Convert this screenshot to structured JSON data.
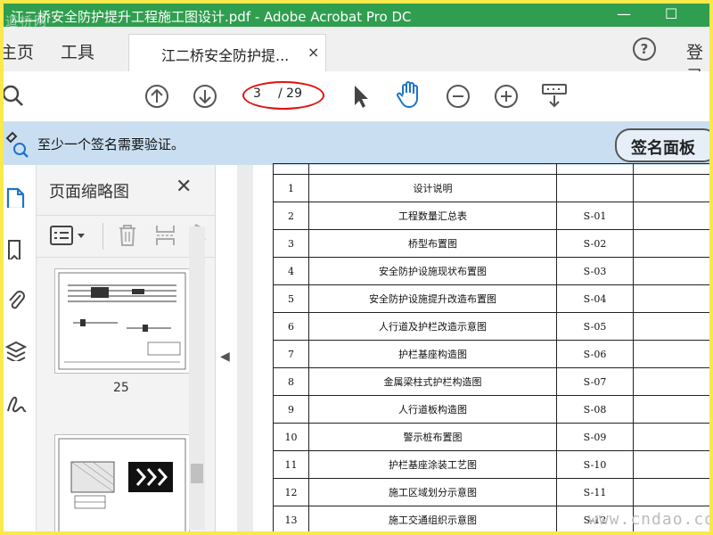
{
  "window": {
    "title": "江二桥安全防护提升工程施工图设计.pdf - Adobe Acrobat Pro DC",
    "watermark_logo": "道桥网",
    "minimize": "—",
    "maximize": "☐"
  },
  "tabs": {
    "home": "主页",
    "tools": "工具",
    "document_tab": "江二桥安全防护提...",
    "close_symbol": "×",
    "sign_in": "登录"
  },
  "toolbar": {
    "current_page": "3",
    "total_pages": "/ 29"
  },
  "signature_bar": {
    "message": "至少一个签名需要验证。",
    "panel_button": "签名面板"
  },
  "thumbnails_panel": {
    "title": "页面缩略图",
    "close_symbol": "✕",
    "thumbnail_page_label": "25"
  },
  "drawing_index": {
    "rows": [
      {
        "no": "1",
        "name": "设计说明",
        "code": ""
      },
      {
        "no": "2",
        "name": "工程数量汇总表",
        "code": "S-01"
      },
      {
        "no": "3",
        "name": "桥型布置图",
        "code": "S-02"
      },
      {
        "no": "4",
        "name": "安全防护设施现状布置图",
        "code": "S-03"
      },
      {
        "no": "5",
        "name": "安全防护设施提升改造布置图",
        "code": "S-04"
      },
      {
        "no": "6",
        "name": "人行道及护栏改造示意图",
        "code": "S-05"
      },
      {
        "no": "7",
        "name": "护栏基座构造图",
        "code": "S-06"
      },
      {
        "no": "8",
        "name": "金属梁柱式护栏构造图",
        "code": "S-07"
      },
      {
        "no": "9",
        "name": "人行道板构造图",
        "code": "S-08"
      },
      {
        "no": "10",
        "name": "警示桩布置图",
        "code": "S-09"
      },
      {
        "no": "11",
        "name": "护栏基座涂装工艺图",
        "code": "S-10"
      },
      {
        "no": "12",
        "name": "施工区域划分示意图",
        "code": "S-11"
      },
      {
        "no": "13",
        "name": "施工交通组织示意图",
        "code": "S-12"
      }
    ]
  },
  "site_watermark": "www.cndao.com",
  "colors": {
    "titlebar": "#2f9e4f",
    "signature_bar": "#c9dff1",
    "annotation_oval": "#e01010",
    "accent_blue": "#1f73c9",
    "frame": "#f9e94a"
  }
}
